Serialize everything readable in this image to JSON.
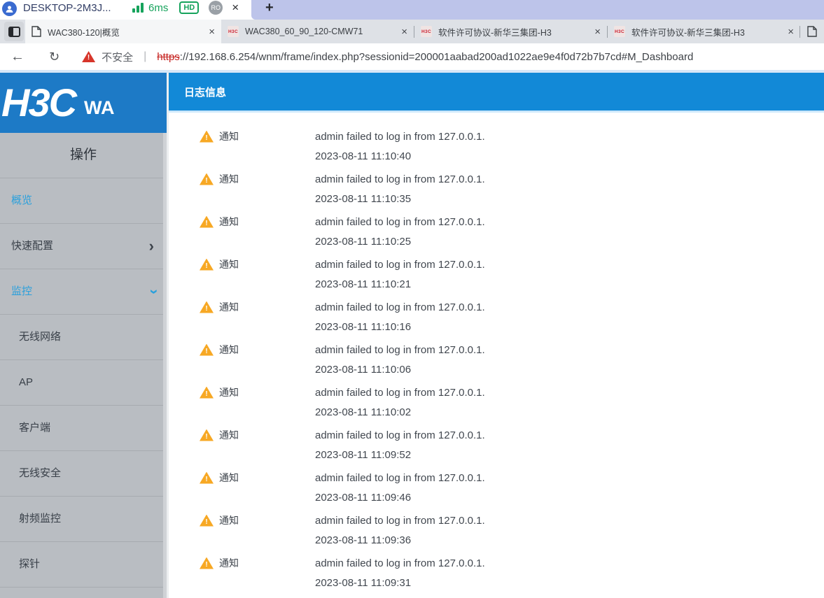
{
  "titlebar": {
    "machine_name": "DESKTOP-2M3J...",
    "latency": "6ms",
    "hd_badge": "HD",
    "ro_badge": "RO",
    "close_glyph": "×",
    "new_tab_glyph": "+"
  },
  "browser": {
    "tabs": [
      {
        "title": "WAC380-120|概览",
        "favicon": "document",
        "active": true
      },
      {
        "title": "WAC380_60_90_120-CMW71",
        "favicon": "h3c",
        "active": false
      },
      {
        "title": "软件许可协议-新华三集团-H3",
        "favicon": "h3c",
        "active": false
      },
      {
        "title": "软件许可协议-新华三集团-H3",
        "favicon": "h3c",
        "active": false
      }
    ],
    "favicon_h3c_text": "H3C",
    "address": {
      "back_glyph": "←",
      "refresh_glyph": "↻",
      "security_label": "不安全",
      "separator": "|",
      "protocol": "https",
      "url_rest": "://192.168.6.254/wnm/frame/index.php?sessionid=200001aabad200ad1022ae9e4f0d72b7b7cd#M_Dashboard"
    }
  },
  "sidebar": {
    "logo": "H3C",
    "model_partial": "WA",
    "section_title": "操作",
    "items": [
      {
        "label": "概览",
        "active": true,
        "sub": false,
        "chevron": ""
      },
      {
        "label": "快速配置",
        "active": false,
        "sub": false,
        "chevron": "right"
      },
      {
        "label": "监控",
        "active": true,
        "sub": false,
        "chevron": "down"
      },
      {
        "label": "无线网络",
        "active": false,
        "sub": true,
        "chevron": ""
      },
      {
        "label": "AP",
        "active": false,
        "sub": true,
        "chevron": ""
      },
      {
        "label": "客户端",
        "active": false,
        "sub": true,
        "chevron": ""
      },
      {
        "label": "无线安全",
        "active": false,
        "sub": true,
        "chevron": ""
      },
      {
        "label": "射频监控",
        "active": false,
        "sub": true,
        "chevron": ""
      },
      {
        "label": "探针",
        "active": false,
        "sub": true,
        "chevron": ""
      }
    ]
  },
  "main": {
    "panel_title": "日志信息",
    "log_type_label": "通知",
    "entries": [
      {
        "message": "admin failed to log in from 127.0.0.1.",
        "time": "2023-08-11 11:10:40"
      },
      {
        "message": "admin failed to log in from 127.0.0.1.",
        "time": "2023-08-11 11:10:35"
      },
      {
        "message": "admin failed to log in from 127.0.0.1.",
        "time": "2023-08-11 11:10:25"
      },
      {
        "message": "admin failed to log in from 127.0.0.1.",
        "time": "2023-08-11 11:10:21"
      },
      {
        "message": "admin failed to log in from 127.0.0.1.",
        "time": "2023-08-11 11:10:16"
      },
      {
        "message": "admin failed to log in from 127.0.0.1.",
        "time": "2023-08-11 11:10:06"
      },
      {
        "message": "admin failed to log in from 127.0.0.1.",
        "time": "2023-08-11 11:10:02"
      },
      {
        "message": "admin failed to log in from 127.0.0.1.",
        "time": "2023-08-11 11:09:52"
      },
      {
        "message": "admin failed to log in from 127.0.0.1.",
        "time": "2023-08-11 11:09:46"
      },
      {
        "message": "admin failed to log in from 127.0.0.1.",
        "time": "2023-08-11 11:09:36"
      },
      {
        "message": "admin failed to log in from 127.0.0.1.",
        "time": "2023-08-11 11:09:31"
      }
    ]
  },
  "colors": {
    "header_blue": "#1289d7",
    "logo_blue": "#1d7ac6",
    "sidebar_gray": "#b9bdc2",
    "active_link_blue": "#2aa0dc",
    "warning_amber": "#f7a824",
    "danger_red": "#d7352a",
    "green_status": "#16a35c",
    "lavender_strip": "#bdc4ea"
  }
}
